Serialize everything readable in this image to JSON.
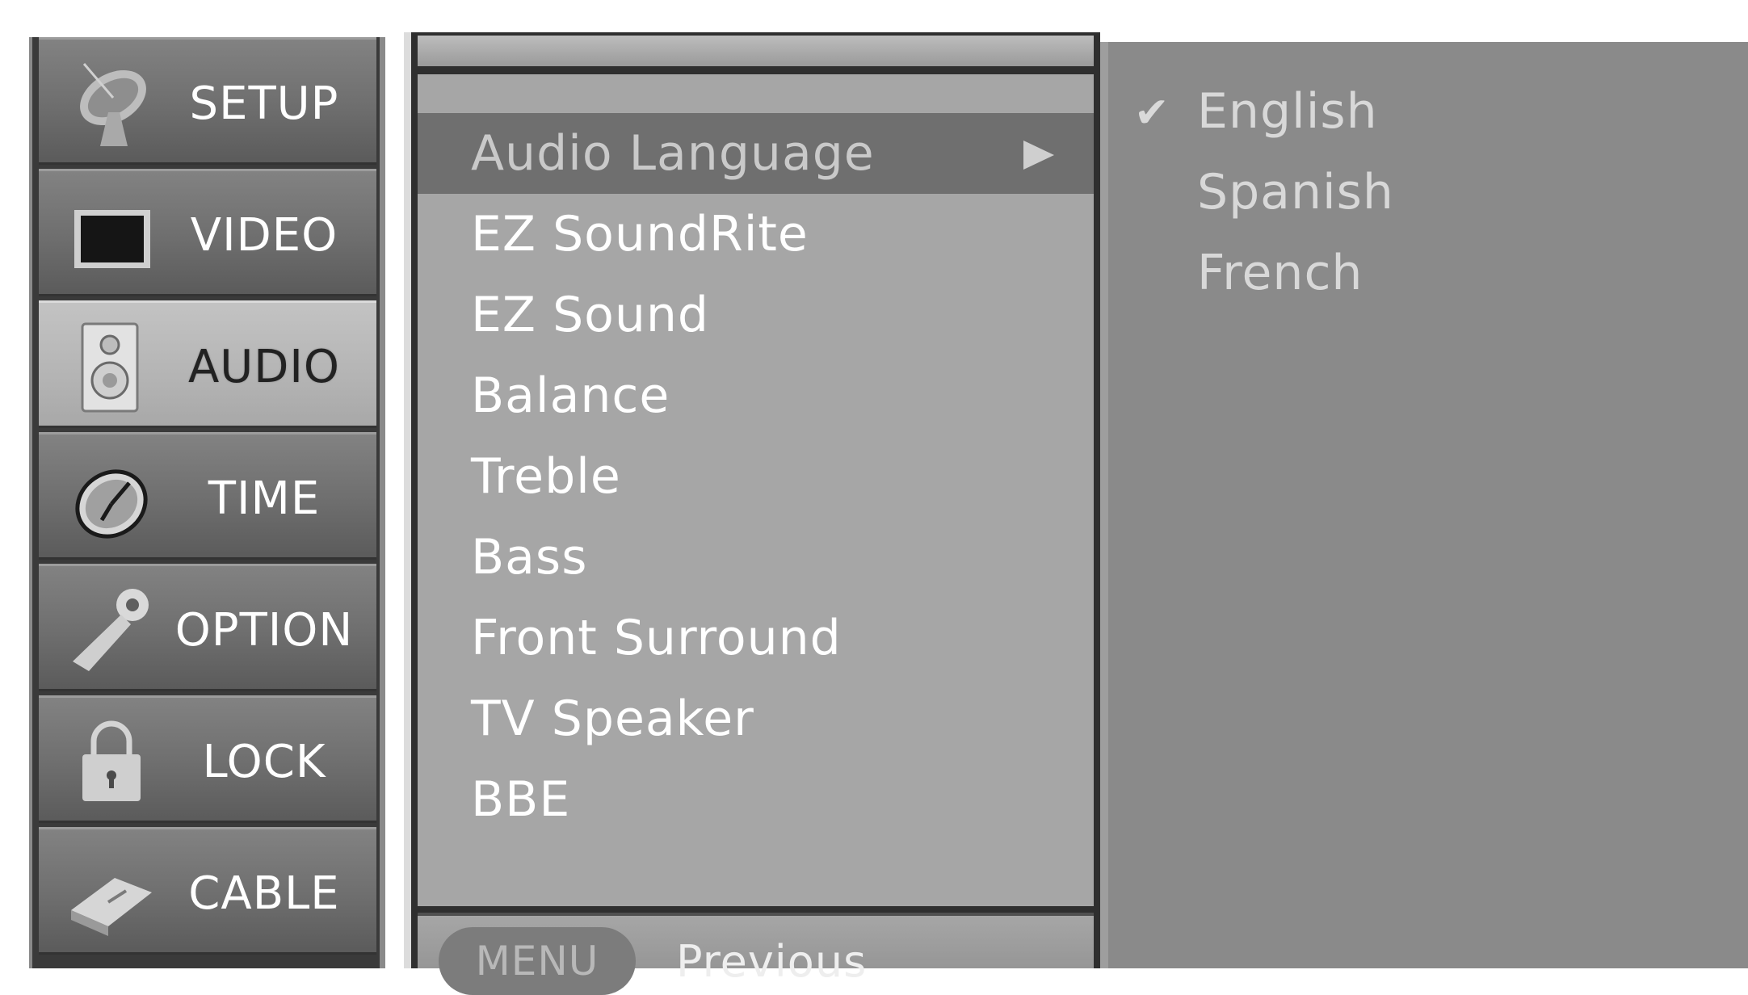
{
  "categories": [
    {
      "label": "SETUP",
      "icon": "satellite-dish-icon",
      "active": false
    },
    {
      "label": "VIDEO",
      "icon": "tv-screen-icon",
      "active": false
    },
    {
      "label": "AUDIO",
      "icon": "speaker-icon",
      "active": true
    },
    {
      "label": "TIME",
      "icon": "clock-icon",
      "active": false
    },
    {
      "label": "OPTION",
      "icon": "wrench-icon",
      "active": false
    },
    {
      "label": "LOCK",
      "icon": "padlock-icon",
      "active": false
    },
    {
      "label": "CABLE",
      "icon": "cable-card-icon",
      "active": false
    }
  ],
  "submenu": {
    "items": [
      {
        "label": "Audio Language",
        "selected": true,
        "has_submenu": true
      },
      {
        "label": "EZ SoundRite"
      },
      {
        "label": "EZ Sound"
      },
      {
        "label": "Balance"
      },
      {
        "label": "Treble"
      },
      {
        "label": "Bass"
      },
      {
        "label": "Front Surround"
      },
      {
        "label": "TV Speaker"
      },
      {
        "label": "BBE"
      }
    ],
    "footer": {
      "menu_button": "MENU",
      "previous_label": "Previous"
    }
  },
  "options": {
    "items": [
      {
        "label": "English",
        "checked": true,
        "check_glyph": "✔"
      },
      {
        "label": "Spanish",
        "checked": false
      },
      {
        "label": "French",
        "checked": false
      }
    ]
  },
  "colors": {
    "active_tab": "#b4b4b4",
    "selected_row": "#6f6f6f",
    "panel": "#a6a6a6",
    "options_bg": "#8a8a8a"
  }
}
